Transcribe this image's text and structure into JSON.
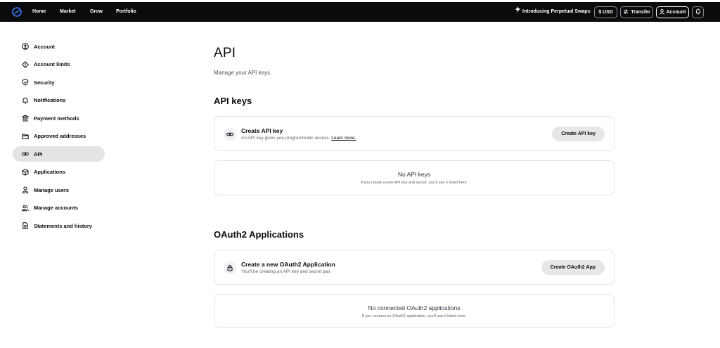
{
  "nav": {
    "links": [
      "Home",
      "Market",
      "Grow",
      "Portfolio"
    ],
    "promo": "Introducing Perpetual Swaps",
    "currency": "$ USD",
    "transfer": "Transfer",
    "account": "Account"
  },
  "sidebar": {
    "items": [
      {
        "label": "Account",
        "icon": "account-circle-icon"
      },
      {
        "label": "Account limits",
        "icon": "limits-icon"
      },
      {
        "label": "Security",
        "icon": "shield-icon"
      },
      {
        "label": "Notifications",
        "icon": "bell-icon"
      },
      {
        "label": "Payment methods",
        "icon": "bank-icon"
      },
      {
        "label": "Approved addresses",
        "icon": "folder-icon"
      },
      {
        "label": "API",
        "icon": "link-icon",
        "selected": true
      },
      {
        "label": "Applications",
        "icon": "cube-icon"
      },
      {
        "label": "Manage users",
        "icon": "user-icon"
      },
      {
        "label": "Manage accounts",
        "icon": "users-icon"
      },
      {
        "label": "Statements and history",
        "icon": "document-icon"
      }
    ]
  },
  "main": {
    "title": "API",
    "subtitle": "Manage your API keys.",
    "api_keys": {
      "heading": "API keys",
      "create_title": "Create API key",
      "create_desc": "An API key gives you programmatic access.",
      "learn_more": "Learn more.",
      "create_button": "Create API key",
      "empty_title": "No API keys",
      "empty_desc": "If you create a new API key and secret, you'll see it listed here."
    },
    "oauth": {
      "heading": "OAuth2 Applications",
      "create_title": "Create a new OAuth2 Application",
      "create_desc": "You'll be creating an API key and secret pair.",
      "create_button": "Create OAuth2 App",
      "empty_title": "No connected OAuth2 applications",
      "empty_desc": "If you connect an OAuth2 application, you'll see it listed here."
    }
  },
  "colors": {
    "topbar": "#0a0b0d",
    "accent_logo": "#0052ff",
    "selected_bg": "#e3e4e6"
  }
}
